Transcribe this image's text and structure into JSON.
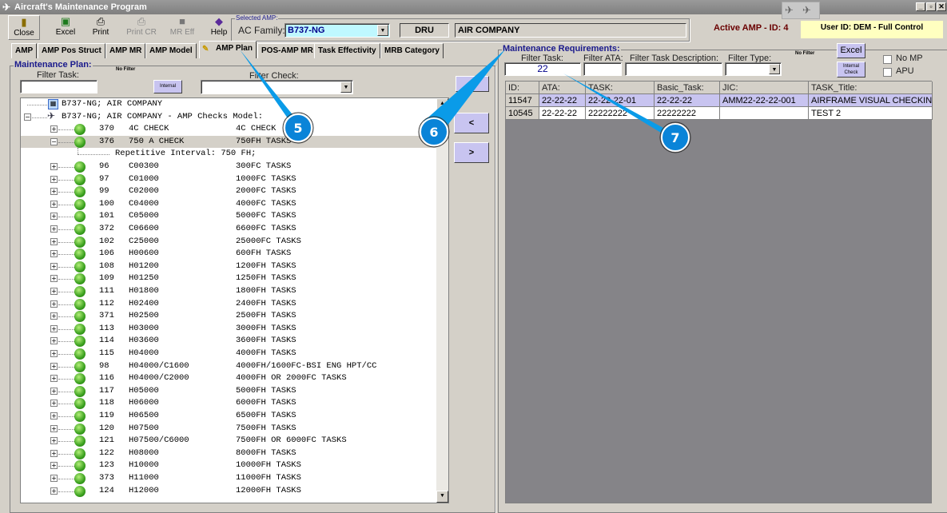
{
  "window": {
    "title": "Aircraft's Maintenance Program"
  },
  "toolbar": [
    {
      "label": "Close",
      "icon": "door-exit-icon"
    },
    {
      "label": "Excel",
      "icon": "excel-icon"
    },
    {
      "label": "Print",
      "icon": "printer-icon"
    },
    {
      "label": "Print CR",
      "icon": "printer-icon"
    },
    {
      "label": "MR Eff",
      "icon": "square-icon"
    },
    {
      "label": "Help",
      "icon": "help-book-icon"
    }
  ],
  "selected_amp": {
    "title": "Selected AMP:",
    "ac_family_label": "AC Family:",
    "ac_family": "B737-NG",
    "operator_code": "DRU",
    "operator_name": "AIR COMPANY"
  },
  "status": {
    "active_amp": "Active AMP - ID: 4",
    "user": "User ID: DEM - Full Control"
  },
  "tabs": [
    "AMP",
    "AMP Pos Struct",
    "AMP MR",
    "AMP Model",
    "AMP Plan",
    "POS-AMP MR",
    "Task Effectivity",
    "MRB Category"
  ],
  "active_tab": "AMP Plan",
  "plan": {
    "title": "Maintenance Plan:",
    "filter_task_label": "Filter Task:",
    "no_filter": "No Filter",
    "internal_btn": "Internal",
    "filter_check_label": "Filter Check:",
    "filter_task": "",
    "filter_check": ""
  },
  "tree": {
    "root": "B737-NG;  AIR COMPANY",
    "model": "B737-NG;  AIR COMPANY - AMP Checks Model:",
    "repetitive": "Repetitive Interval:  750 FH;",
    "checks": [
      {
        "id": "370",
        "code": "4C CHECK",
        "desc": "4C CHECK"
      },
      {
        "id": "376",
        "code": "750 A CHECK",
        "desc": "750FH TASKS",
        "expanded": true
      },
      {
        "id": "96",
        "code": "C00300",
        "desc": "300FC TASKS"
      },
      {
        "id": "97",
        "code": "C01000",
        "desc": "1000FC TASKS"
      },
      {
        "id": "99",
        "code": "C02000",
        "desc": "2000FC TASKS"
      },
      {
        "id": "100",
        "code": "C04000",
        "desc": "4000FC TASKS"
      },
      {
        "id": "101",
        "code": "C05000",
        "desc": "5000FC TASKS"
      },
      {
        "id": "372",
        "code": "C06600",
        "desc": "6600FC TASKS"
      },
      {
        "id": "102",
        "code": "C25000",
        "desc": "25000FC TASKS"
      },
      {
        "id": "106",
        "code": "H00600",
        "desc": "600FH TASKS"
      },
      {
        "id": "108",
        "code": "H01200",
        "desc": "1200FH TASKS"
      },
      {
        "id": "109",
        "code": "H01250",
        "desc": "1250FH TASKS"
      },
      {
        "id": "111",
        "code": "H01800",
        "desc": "1800FH TASKS"
      },
      {
        "id": "112",
        "code": "H02400",
        "desc": "2400FH TASKS"
      },
      {
        "id": "371",
        "code": "H02500",
        "desc": "2500FH TASKS"
      },
      {
        "id": "113",
        "code": "H03000",
        "desc": "3000FH TASKS"
      },
      {
        "id": "114",
        "code": "H03600",
        "desc": "3600FH TASKS"
      },
      {
        "id": "115",
        "code": "H04000",
        "desc": "4000FH TASKS"
      },
      {
        "id": "98",
        "code": "H04000/C1600",
        "desc": "4000FH/1600FC-BSI ENG HPT/CC"
      },
      {
        "id": "116",
        "code": "H04000/C2000",
        "desc": "4000FH OR 2000FC TASKS"
      },
      {
        "id": "117",
        "code": "H05000",
        "desc": "5000FH TASKS"
      },
      {
        "id": "118",
        "code": "H06000",
        "desc": "6000FH TASKS"
      },
      {
        "id": "119",
        "code": "H06500",
        "desc": "6500FH TASKS"
      },
      {
        "id": "120",
        "code": "H07500",
        "desc": "7500FH TASKS"
      },
      {
        "id": "121",
        "code": "H07500/C6000",
        "desc": "7500FH OR 6000FC TASKS"
      },
      {
        "id": "122",
        "code": "H08000",
        "desc": "8000FH TASKS"
      },
      {
        "id": "123",
        "code": "H10000",
        "desc": "10000FH TASKS"
      },
      {
        "id": "373",
        "code": "H11000",
        "desc": "11000FH TASKS"
      },
      {
        "id": "124",
        "code": "H12000",
        "desc": "12000FH TASKS"
      }
    ]
  },
  "move": {
    "left": "<",
    "right": ">"
  },
  "req": {
    "title": "Maintenance Requirements:",
    "filter_task_label": "Filter Task:",
    "filter_ata_label": "Filter ATA:",
    "filter_desc_label": "Filter Task Description:",
    "filter_type_label": "Filter Type:",
    "no_filter": "No Filter",
    "filter_task": "22",
    "filter_ata": "",
    "filter_desc": "",
    "filter_type": "",
    "excel_btn": "Excel",
    "internal_btn": "Internal Check",
    "no_mp": "No MP",
    "apu": "APU"
  },
  "grid": {
    "columns": [
      "ID:",
      "ATA:",
      "TASK:",
      "Basic_Task:",
      "JIC:",
      "TASK_Title:"
    ],
    "rows": [
      [
        "11547",
        "22-22-22",
        "22-22-22-01",
        "22-22-22",
        "AMM22-22-22-001",
        "AIRFRAME VISUAL CHECKING"
      ],
      [
        "10545",
        "22-22-22",
        "22222222",
        "22222222",
        "",
        "TEST 2"
      ]
    ]
  },
  "callouts": [
    "5",
    "6",
    "7"
  ]
}
